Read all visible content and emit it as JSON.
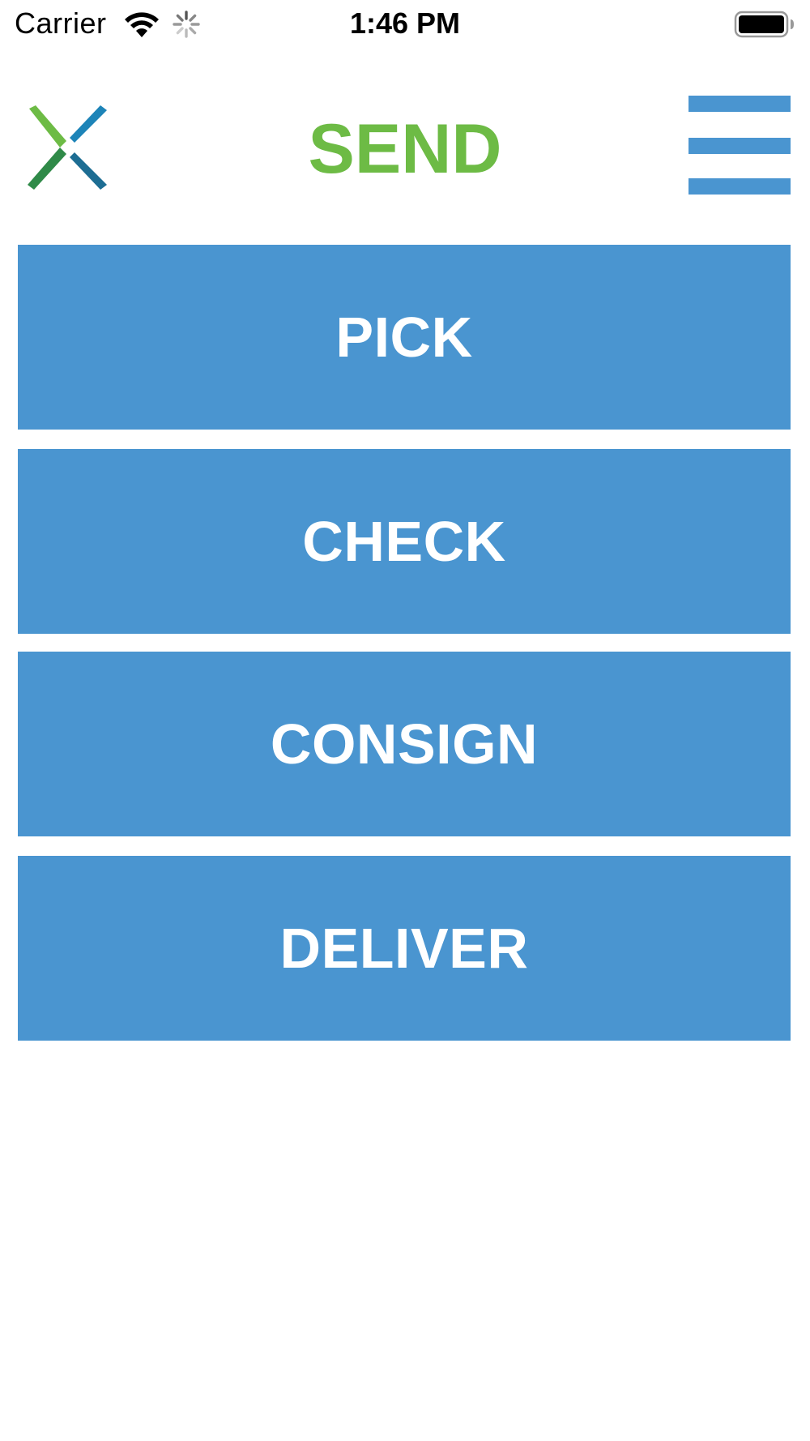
{
  "status_bar": {
    "carrier": "Carrier",
    "time": "1:46 PM",
    "icons": [
      "wifi-icon",
      "activity-spinner-icon",
      "battery-icon"
    ]
  },
  "header": {
    "logo_icon": "x-logo-icon",
    "title": "SEND",
    "title_color": "#6dbb45",
    "menu_icon": "hamburger-menu-icon"
  },
  "actions": [
    {
      "label": "PICK"
    },
    {
      "label": "CHECK"
    },
    {
      "label": "CONSIGN"
    },
    {
      "label": "DELIVER"
    }
  ],
  "colors": {
    "button_bg": "#4a95d0",
    "button_text": "#ffffff",
    "accent_green": "#6dbb45"
  }
}
